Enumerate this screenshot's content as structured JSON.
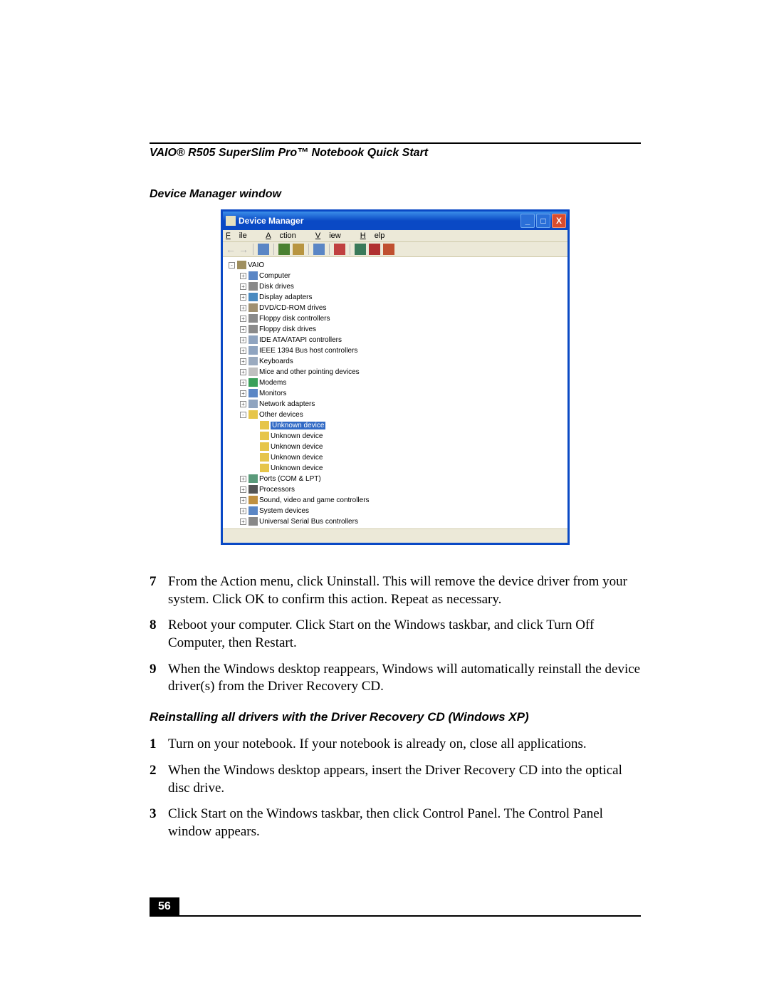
{
  "doc_title": "VAIO® R505 SuperSlim Pro™ Notebook Quick Start",
  "caption": "Device Manager window",
  "window": {
    "title": "Device Manager",
    "menu": [
      "File",
      "Action",
      "View",
      "Help"
    ],
    "menu_underlines": [
      "F",
      "A",
      "V",
      "H"
    ],
    "tree": [
      {
        "indent": 0,
        "exp": "-",
        "icon": "ic-machine",
        "label": "VAIO",
        "selected": false
      },
      {
        "indent": 1,
        "exp": "+",
        "icon": "ic-computer",
        "label": "Computer"
      },
      {
        "indent": 1,
        "exp": "+",
        "icon": "ic-disk",
        "label": "Disk drives"
      },
      {
        "indent": 1,
        "exp": "+",
        "icon": "ic-display",
        "label": "Display adapters"
      },
      {
        "indent": 1,
        "exp": "+",
        "icon": "ic-dvd",
        "label": "DVD/CD-ROM drives"
      },
      {
        "indent": 1,
        "exp": "+",
        "icon": "ic-floppy",
        "label": "Floppy disk controllers"
      },
      {
        "indent": 1,
        "exp": "+",
        "icon": "ic-floppy",
        "label": "Floppy disk drives"
      },
      {
        "indent": 1,
        "exp": "+",
        "icon": "ic-ide",
        "label": "IDE ATA/ATAPI controllers"
      },
      {
        "indent": 1,
        "exp": "+",
        "icon": "ic-1394",
        "label": "IEEE 1394 Bus host controllers"
      },
      {
        "indent": 1,
        "exp": "+",
        "icon": "ic-keyboard",
        "label": "Keyboards"
      },
      {
        "indent": 1,
        "exp": "+",
        "icon": "ic-mouse",
        "label": "Mice and other pointing devices"
      },
      {
        "indent": 1,
        "exp": "+",
        "icon": "ic-modem",
        "label": "Modems"
      },
      {
        "indent": 1,
        "exp": "+",
        "icon": "ic-monitor",
        "label": "Monitors"
      },
      {
        "indent": 1,
        "exp": "+",
        "icon": "ic-net",
        "label": "Network adapters"
      },
      {
        "indent": 1,
        "exp": "-",
        "icon": "ic-other",
        "label": "Other devices"
      },
      {
        "indent": 2,
        "exp": "",
        "icon": "ic-unknown",
        "label": "Unknown device",
        "selected": true
      },
      {
        "indent": 2,
        "exp": "",
        "icon": "ic-unknown",
        "label": "Unknown device"
      },
      {
        "indent": 2,
        "exp": "",
        "icon": "ic-unknown",
        "label": "Unknown device"
      },
      {
        "indent": 2,
        "exp": "",
        "icon": "ic-unknown",
        "label": "Unknown device"
      },
      {
        "indent": 2,
        "exp": "",
        "icon": "ic-unknown",
        "label": "Unknown device"
      },
      {
        "indent": 1,
        "exp": "+",
        "icon": "ic-port",
        "label": "Ports (COM & LPT)"
      },
      {
        "indent": 1,
        "exp": "+",
        "icon": "ic-proc",
        "label": "Processors"
      },
      {
        "indent": 1,
        "exp": "+",
        "icon": "ic-sound",
        "label": "Sound, video and game controllers"
      },
      {
        "indent": 1,
        "exp": "+",
        "icon": "ic-sys",
        "label": "System devices"
      },
      {
        "indent": 1,
        "exp": "+",
        "icon": "ic-usb",
        "label": "Universal Serial Bus controllers"
      }
    ]
  },
  "steps_a": [
    {
      "n": "7",
      "t": "From the Action menu, click Uninstall. This will remove the device driver from your system. Click OK to confirm this action. Repeat as necessary."
    },
    {
      "n": "8",
      "t": "Reboot your computer. Click Start on the Windows taskbar, and click Turn Off Computer, then Restart."
    },
    {
      "n": "9",
      "t": "When the Windows desktop reappears, Windows will automatically reinstall the device driver(s) from the Driver Recovery CD."
    }
  ],
  "subheading": "Reinstalling all drivers with the Driver Recovery CD (Windows XP)",
  "steps_b": [
    {
      "n": "1",
      "t": "Turn on your notebook. If your notebook is already on, close all applications."
    },
    {
      "n": "2",
      "t": "When the Windows desktop appears, insert the Driver Recovery CD into the optical disc drive."
    },
    {
      "n": "3",
      "t": "Click Start on the Windows taskbar, then click Control Panel. The Control Panel window appears."
    }
  ],
  "page_number": "56"
}
